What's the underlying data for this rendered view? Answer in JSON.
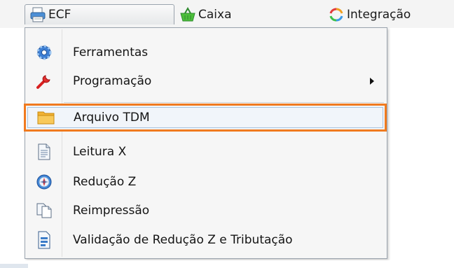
{
  "menubar": {
    "items": [
      {
        "label": "ECF",
        "icon": "printer-icon"
      },
      {
        "label": "Caixa",
        "icon": "basket-icon"
      },
      {
        "label": "Integração",
        "icon": "sync-arrows-icon"
      }
    ]
  },
  "dropdown": {
    "items": [
      {
        "label": "Ferramentas",
        "icon": "gear-icon"
      },
      {
        "label": "Programação",
        "icon": "wrench-icon",
        "submenu": true
      },
      {
        "label": "Arquivo TDM",
        "icon": "folder-icon",
        "highlighted": true
      },
      {
        "label": "Leitura X",
        "icon": "document-icon"
      },
      {
        "label": "Redução Z",
        "icon": "compass-icon"
      },
      {
        "label": "Reimpressão",
        "icon": "copy-pages-icon"
      },
      {
        "label": "Validação de Redução Z e Tributação",
        "icon": "report-icon"
      }
    ]
  },
  "colors": {
    "highlight_border": "#f07a1f",
    "menu_background": "#f6f6f6"
  }
}
